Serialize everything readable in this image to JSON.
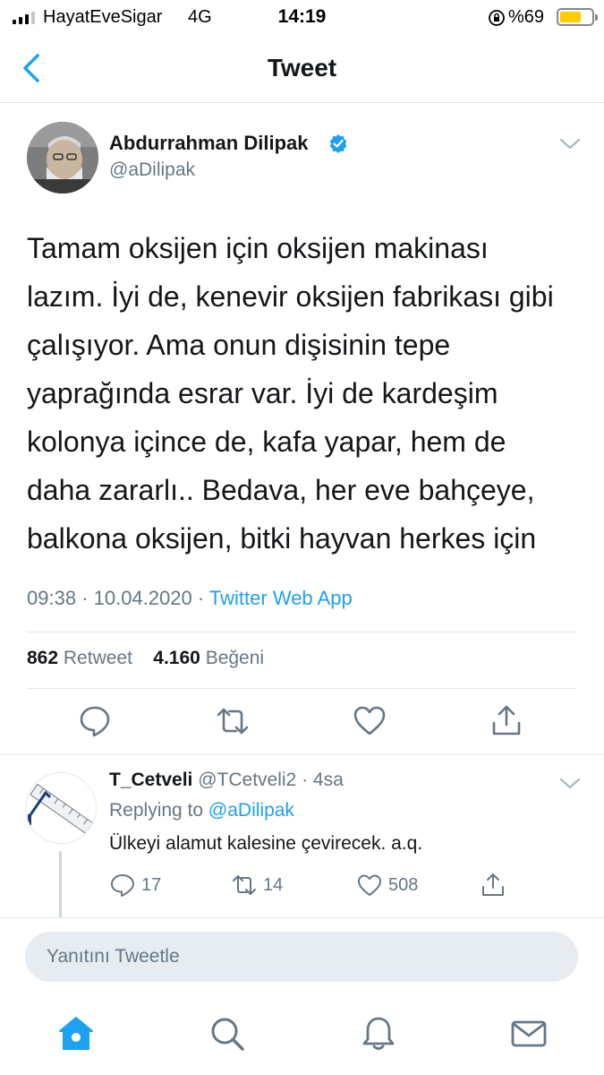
{
  "status_bar": {
    "carrier": "HayatEveSigar",
    "network": "4G",
    "time": "14:19",
    "battery_percent": "%69",
    "battery_level": 0.69
  },
  "nav": {
    "title": "Tweet",
    "back_icon": "chevron-left-icon"
  },
  "tweet": {
    "author_name": "Abdurrahman Dilipak",
    "handle": "@aDilipak",
    "verified": true,
    "lines": [
      "Tamam oksijen için oksijen makinası",
      "lazım. İyi de, kenevir oksijen fabrikası gibi",
      "çalışıyor. Ama onun dişisinin tepe",
      "yaprağında esrar var. İyi de kardeşim",
      "kolonya içince de, kafa yapar, hem de",
      "daha zararlı.. Bedava, her eve bahçeye,",
      "balkona oksijen, bitki hayvan herkes için"
    ],
    "time": "09:38",
    "date": "10.04.2020",
    "separator": "·",
    "source": "Twitter Web App",
    "retweet_count": "862",
    "retweet_label": "Retweet",
    "like_count": "4.160",
    "like_label": "Beğeni"
  },
  "actions": [
    "reply-icon",
    "retweet-icon",
    "like-icon",
    "share-icon"
  ],
  "reply": {
    "name": "T_Cetveli",
    "handle": "@TCetveli2",
    "age": "· 4sa",
    "replying_label": "Replying to",
    "replying_to": "@aDilipak",
    "text": "Ülkeyi alamut kalesine çevirecek. a.q.",
    "reply_count": "17",
    "retweet_count": "14",
    "like_count": "508"
  },
  "composer": {
    "placeholder": "Yanıtını Tweetle"
  },
  "tabbar": [
    "home-icon",
    "search-icon",
    "notifications-icon",
    "messages-icon"
  ],
  "colors": {
    "accent": "#1da1f2",
    "secondary_text": "#657786",
    "divider": "#e1e8ed",
    "battery": "#ffcc00"
  }
}
